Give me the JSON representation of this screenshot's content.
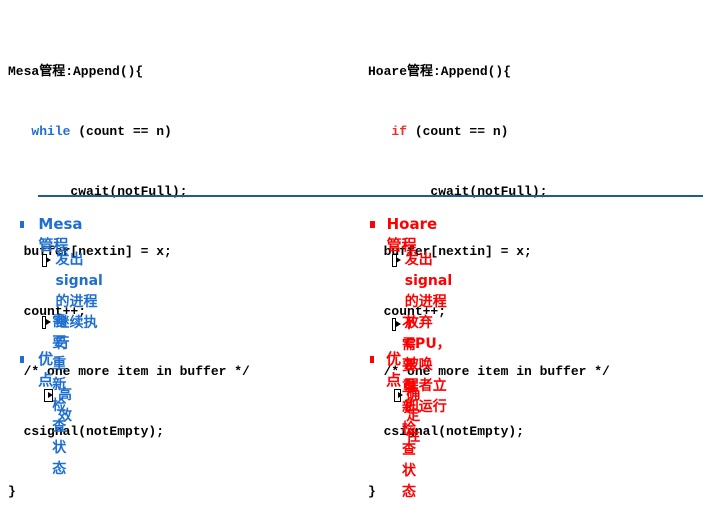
{
  "left": {
    "code_lines": {
      "l1": "Mesa管程:Append(){",
      "l2_kw": "while",
      "l2_rest": " (count == n)",
      "l3": "cwait(notFull);",
      "l4": "buffer[nextin] = x;",
      "l5": "count++;",
      "l6": "/* one more item in buffer */",
      "l7": "csignal(notEmpty);",
      "l8": "}"
    },
    "heading": "Mesa管程",
    "sub1": "发出signal的进程继续执行",
    "sub2": "需要重新检查状态",
    "merit_heading": "优点",
    "merit_sub": "高效",
    "text_color": "#1f6fd1"
  },
  "right": {
    "code_lines": {
      "l1": "Hoare管程:Append(){",
      "l2_kw": "if",
      "l2_rest": " (count == n)",
      "l3": "cwait(notFull);",
      "l4": "buffer[nextin] = x;",
      "l5": "count++;",
      "l6": "/* one more item in buffer */",
      "l7": "csignal(notEmpty);",
      "l8": "}"
    },
    "heading": "Hoare管程",
    "sub1_line1": "发出signal的进程放弃CPU，被唤",
    "sub1_line2": "醒者立即运行",
    "sub2": "不需要重新检查状态",
    "merit_heading": "优点",
    "merit_sub": "确定性",
    "text_color": "#ff0000"
  },
  "divider_color": "#1f5f87",
  "icons": {
    "bullet": "square-bullet-icon",
    "sub_bullet": "play-box-icon"
  }
}
